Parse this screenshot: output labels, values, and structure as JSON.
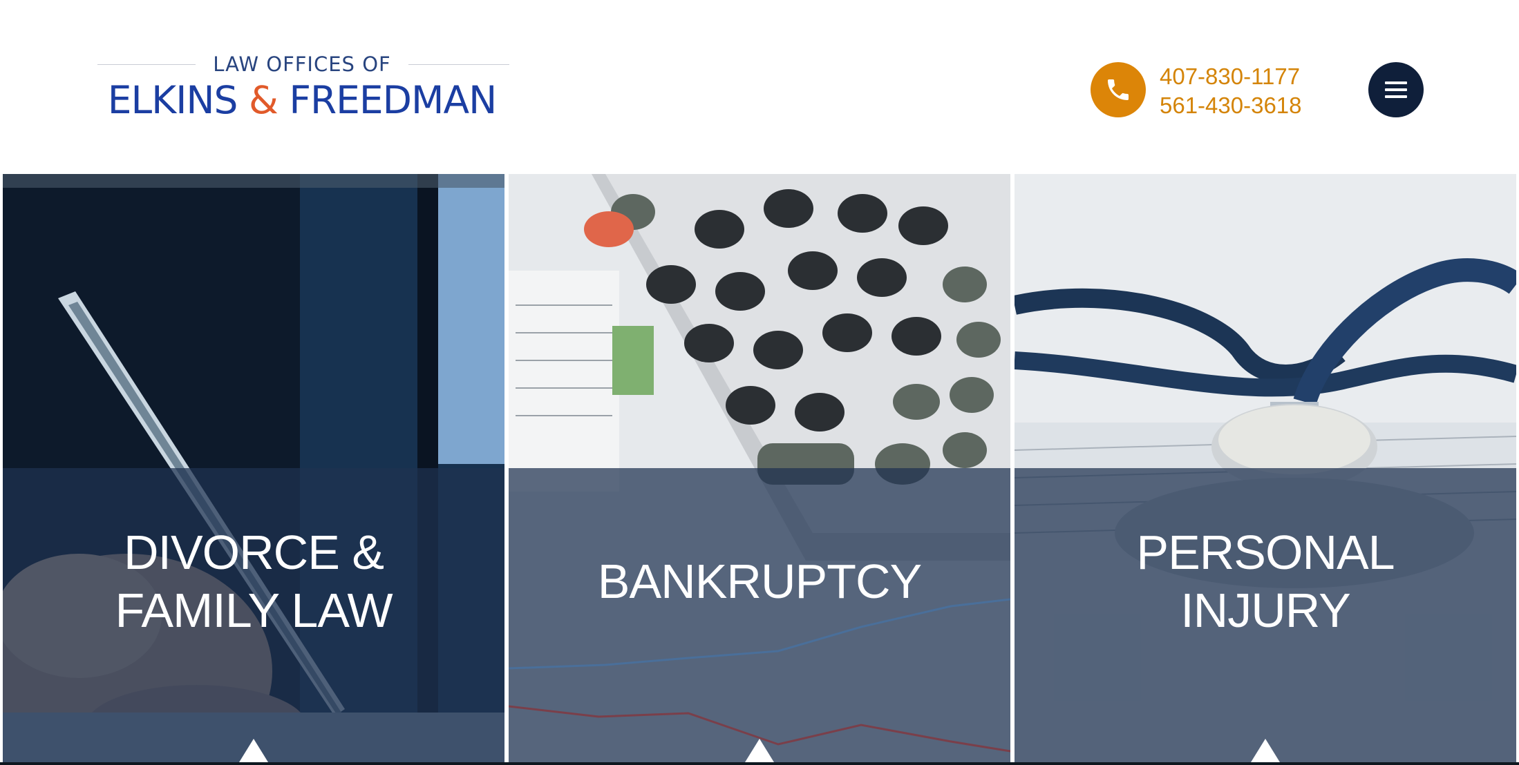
{
  "header": {
    "logo_top": "LAW OFFICES OF",
    "logo_name_left": "ELKINS ",
    "logo_amp": "&",
    "logo_name_right": " FREEDMAN",
    "phone_1": "407-830-1177",
    "phone_2": "561-430-3618",
    "phone_icon": "phone-icon",
    "menu_icon": "hamburger-menu-icon"
  },
  "practice_areas": [
    {
      "title_line_1": "DIVORCE &",
      "title_line_2": "FAMILY LAW"
    },
    {
      "title_line_1": "BANKRUPTCY",
      "title_line_2": ""
    },
    {
      "title_line_1": "PERSONAL",
      "title_line_2": "INJURY"
    }
  ],
  "colors": {
    "brand_blue": "#1b3ea2",
    "accent_orange": "#e15a2a",
    "phone_gold": "#d48408",
    "menu_navy": "#0f1f3a",
    "overlay": "#1e3250"
  }
}
